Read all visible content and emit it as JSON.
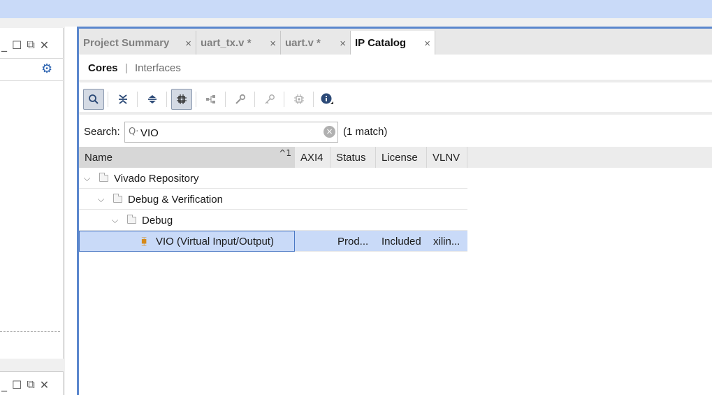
{
  "left_panel": {
    "window_controls": [
      "minimize-icon",
      "maximize-icon",
      "float-icon",
      "close-icon"
    ],
    "settings_icon": "gear-icon"
  },
  "tabs": [
    {
      "label": "Project Summary",
      "active": false,
      "close": "×"
    },
    {
      "label": "uart_tx.v *",
      "active": false,
      "close": "×"
    },
    {
      "label": "uart.v *",
      "active": false,
      "close": "×"
    },
    {
      "label": "IP Catalog",
      "active": true,
      "close": "×"
    }
  ],
  "subtabs": {
    "cores": "Cores",
    "separator": "|",
    "interfaces": "Interfaces"
  },
  "toolbar": [
    "search-icon",
    "collapse-all-icon",
    "expand-all-icon",
    "filter-icon",
    "hierarchy-icon",
    "wrench-icon",
    "key-icon",
    "chip-icon",
    "info-icon"
  ],
  "search": {
    "label": "Search:",
    "value": "VIO",
    "icon": "Q·",
    "clear": "×",
    "match_text": "(1 match)"
  },
  "table": {
    "columns": [
      "Name",
      "AXI4",
      "Status",
      "License",
      "VLNV"
    ],
    "sort_indicator": "^1",
    "rows": [
      {
        "indent": 0,
        "name": "Vivado Repository",
        "type": "folder",
        "axi4": "",
        "status": "",
        "license": "",
        "vlnv": ""
      },
      {
        "indent": 1,
        "name": "Debug & Verification",
        "type": "folder",
        "axi4": "",
        "status": "",
        "license": "",
        "vlnv": ""
      },
      {
        "indent": 2,
        "name": "Debug",
        "type": "folder",
        "axi4": "",
        "status": "",
        "license": "",
        "vlnv": ""
      },
      {
        "indent": 3,
        "name": "VIO (Virtual Input/Output)",
        "type": "ip",
        "axi4": "",
        "status": "Prod...",
        "license": "Included",
        "vlnv": "xilin..."
      }
    ]
  },
  "colors": {
    "accent": "#5b87cd",
    "selection": "#c9daf8",
    "title_bar": "#c9daf8",
    "ip_icon": "#d68a1a"
  }
}
